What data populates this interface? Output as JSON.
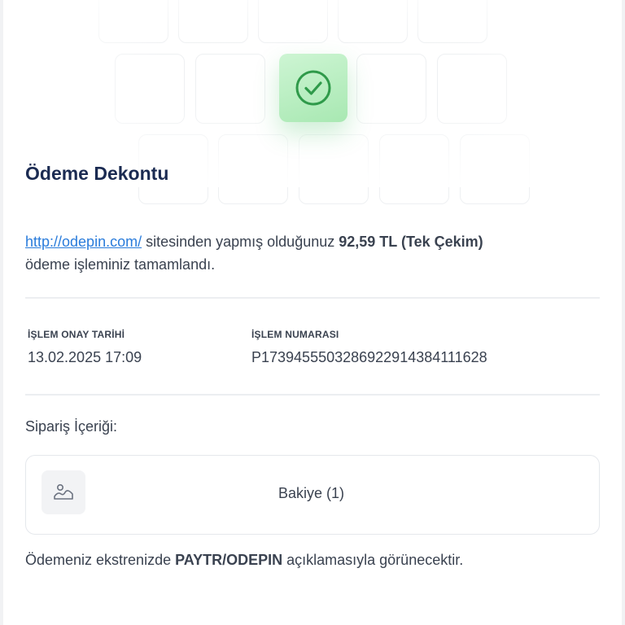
{
  "receipt": {
    "title": "Ödeme Dekontu",
    "site_link": "http://odepin.com/",
    "desc_mid": " sitesinden yapmış olduğunuz ",
    "amount": "92,59 TL (Tek Çekim)",
    "desc_end": "ödeme işleminiz tamamlandı.",
    "approval_date_label": "İŞLEM ONAY TARİHİ",
    "approval_date_value": "13.02.2025 17:09",
    "transaction_no_label": "İŞLEM NUMARASI",
    "transaction_no_value": "P173945550328692291438411162 8"
  },
  "order": {
    "title": "Sipariş İçeriği:",
    "items": [
      {
        "name": "Bakiye (1)",
        "icon": "image-placeholder-icon"
      }
    ]
  },
  "footer": {
    "prefix": "Ödemeniz ekstrenizde ",
    "descriptor": "PAYTR/ODEPIN",
    "suffix": " açıklamasıyla görünecektir."
  },
  "colors": {
    "title": "#1b2b52",
    "link": "#2a7cdb",
    "success_tile": "#b5ecbd",
    "success_check": "#2f9a4a",
    "text": "#3a4250"
  },
  "icons": {
    "status": "check-circle-icon",
    "item": "image-placeholder-icon"
  }
}
